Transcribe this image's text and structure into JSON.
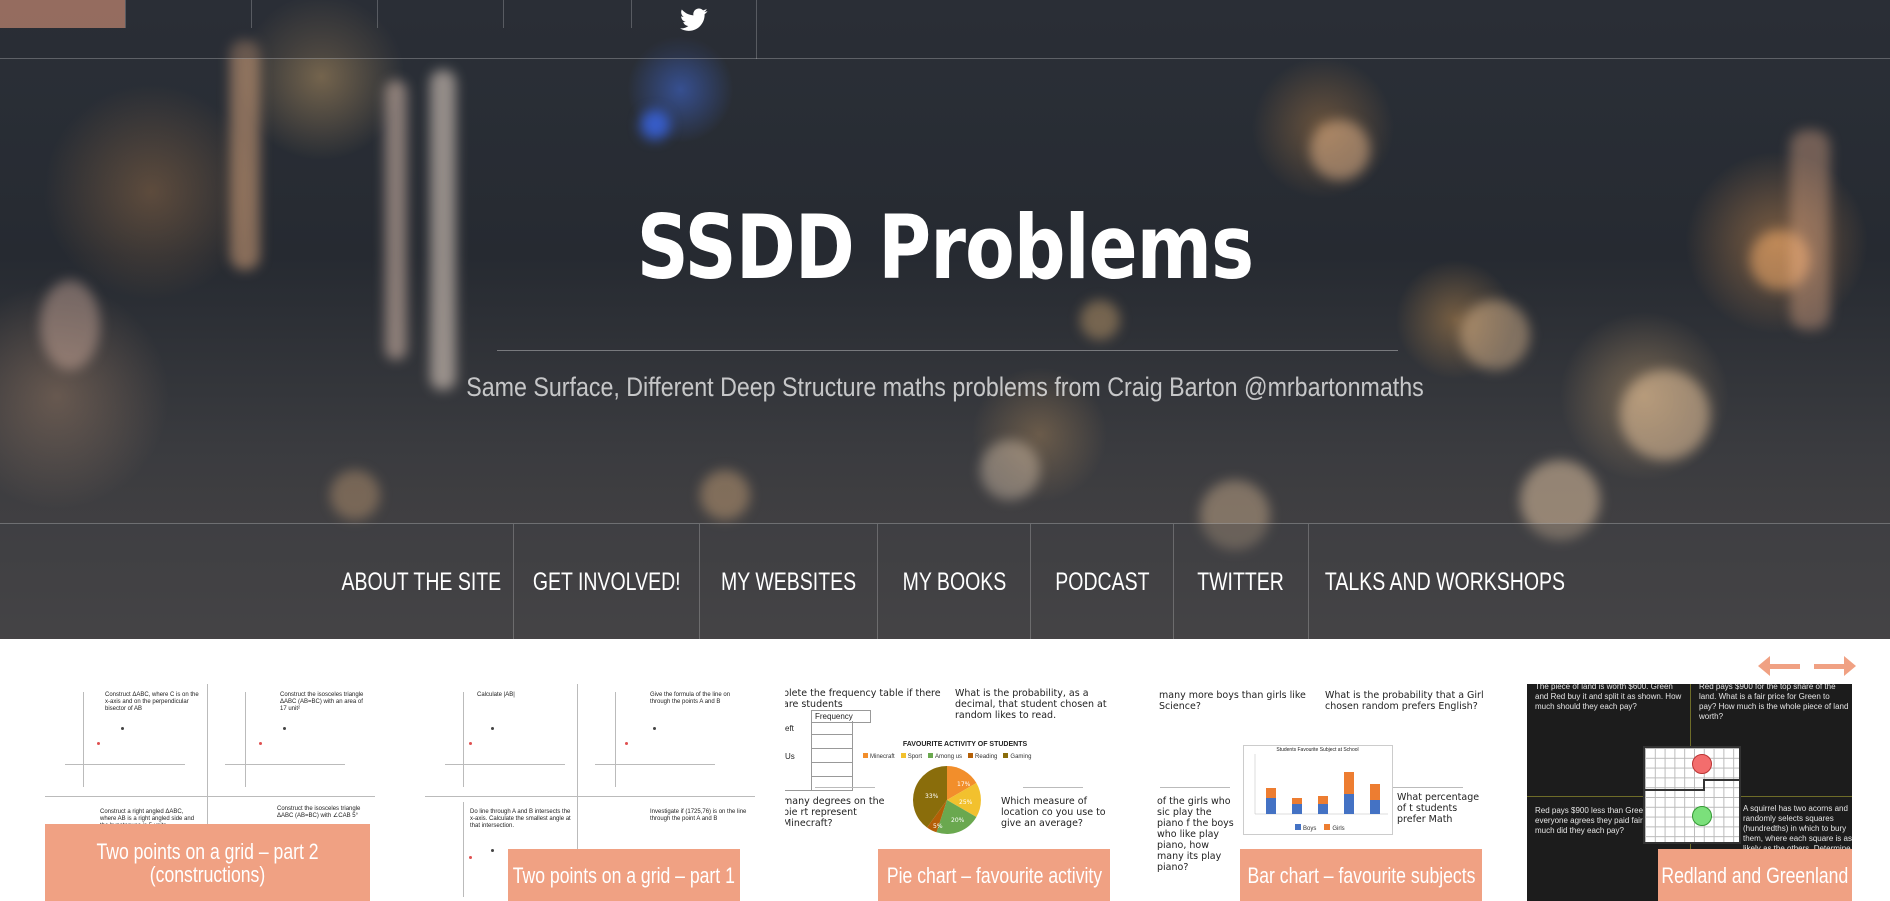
{
  "site": {
    "title": "SSDD Problems",
    "tagline": "Same Surface, Different Deep Structure maths problems from Craig Barton @mrbartonmaths"
  },
  "topbar": {
    "social_icons": [
      "twitter-icon"
    ]
  },
  "nav": {
    "items": [
      {
        "label": "About the site"
      },
      {
        "label": "Get involved!"
      },
      {
        "label": "My websites"
      },
      {
        "label": "My books"
      },
      {
        "label": "Podcast"
      },
      {
        "label": "Twitter"
      },
      {
        "label": "Talks and Workshops"
      }
    ]
  },
  "slider": {
    "prev_icon": "arrow-left-icon",
    "next_icon": "arrow-right-icon",
    "cards": [
      {
        "label": "Two points on a grid – part 2 (constructions)",
        "snippets": [
          "Construct ΔABC, where C is on the x-axis and on the perpendicular bisector of AB",
          "Construct the isosceles triangle ΔABC (AB=BC) with an area of 17 unit²",
          "Construct a right angled ΔABC, where AB is a right angled side and the hypotenuse is 5 units",
          "Construct the isosceles triangle ΔABC (AB=BC) with ∠CAB 5°"
        ]
      },
      {
        "label": "Two points on a grid – part 1",
        "snippets": [
          "Calculate |AB|",
          "Give the formula of the line on through the points A and B",
          "Do line through A and B intersects the x-axis. Calculate the smallest angle at that intersection.",
          "Investigate if (1725,76) is on the line through the point A and B"
        ]
      },
      {
        "label": "Pie chart – favourite activity",
        "snippets": [
          "plete the frequency table if there are students",
          "Frequency",
          "eft",
          "Us",
          "What is the probability, as a decimal, that student chosen at random likes to read.",
          "FAVOURITE ACTIVITY OF STUDENTS",
          "many degrees on the pie rt represent Minecraft?",
          "Which measure of location co you use to give an average?"
        ],
        "legend": [
          "Minecraft",
          "Sport",
          "Among us",
          "Reading",
          "Gaming"
        ],
        "slice_labels": [
          "33%",
          "17%",
          "25%",
          "5%",
          "20%"
        ]
      },
      {
        "label": "Bar chart – favourite subjects",
        "snippets": [
          "many more boys than girls like Science?",
          "What is the probability that a Girl chosen random prefers English?",
          "Students Favourite Subject at School",
          "of the girls who sic play the piano f the boys who like play piano, how many its play piano?",
          "What percentage of t students prefer Math"
        ],
        "legend": [
          "Boys",
          "Girls"
        ]
      },
      {
        "label": "Redland and Greenland",
        "snippets": [
          "The piece of land is worth $600. Green and Red buy it and split it as shown. How much should they each pay?",
          "Red pays $900 for the top share of the land. What is a fair price for Green to pay? How much is the whole piece of land worth?",
          "Red pays $900 less than Green and everyone agrees they paid fairly. How much did they each pay?",
          "A squirrel has two acorns and randomly selects squares (hundredths) in which to bury them, where each square is as likely as the others. Determine"
        ]
      }
    ]
  },
  "colors": {
    "accent": "#f0a183",
    "nav_text": "#ffffff",
    "hero_overlay": "#2b3038"
  }
}
